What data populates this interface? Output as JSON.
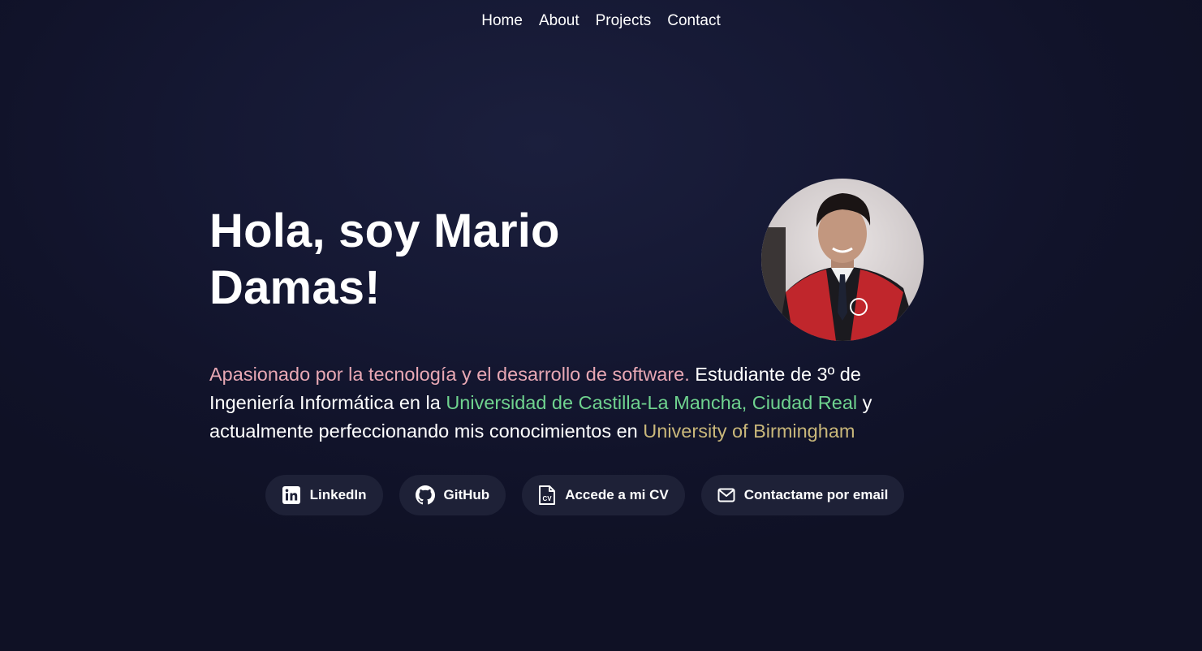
{
  "nav": {
    "items": [
      {
        "label": "Home"
      },
      {
        "label": "About"
      },
      {
        "label": "Projects"
      },
      {
        "label": "Contact"
      }
    ]
  },
  "hero": {
    "title": "Hola, soy Mario Damas!",
    "bio": {
      "part1": "Apasionado por la tecnología y el desarrollo de software.",
      "part2": " Estudiante de 3º de Ingeniería Informática en la ",
      "part3": "Universidad de Castilla-La Mancha, Ciudad Real",
      "part4": " y actualmente perfeccionando mis conocimientos en ",
      "part5": "University of Birmingham"
    },
    "colors": {
      "highlight_pink": "#e8a8b4",
      "highlight_green": "#6fd38f",
      "highlight_gold": "#c9b77a",
      "button_bg": "#1e2137",
      "page_bg": "#13162e"
    }
  },
  "buttons": [
    {
      "label": "LinkedIn",
      "icon": "linkedin-icon"
    },
    {
      "label": "GitHub",
      "icon": "github-icon"
    },
    {
      "label": "Accede a mi CV",
      "icon": "cv-file-icon"
    },
    {
      "label": "Contactame por email",
      "icon": "mail-icon"
    }
  ]
}
